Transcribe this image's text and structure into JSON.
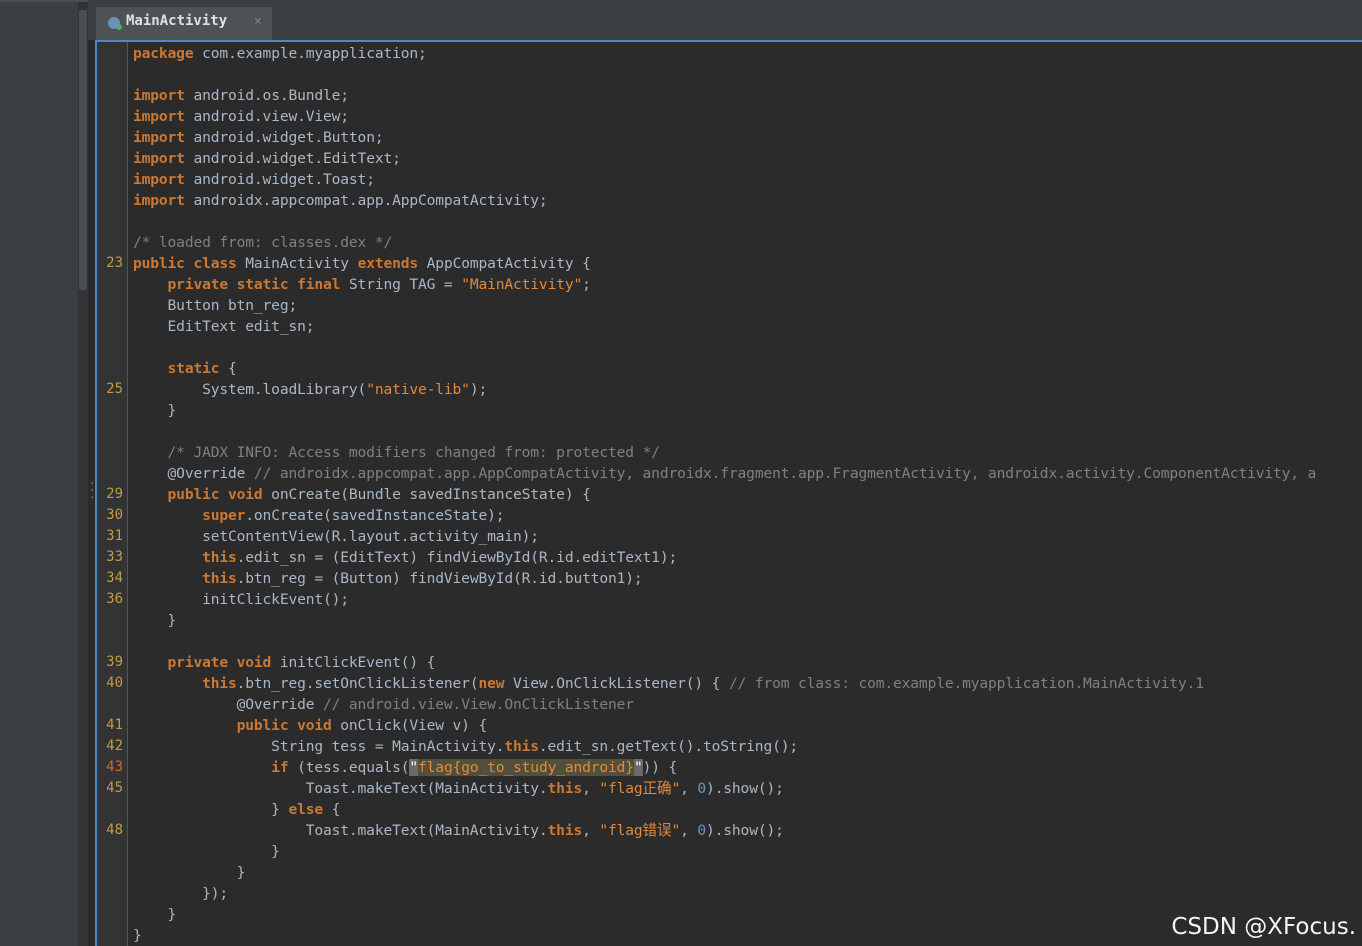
{
  "tab": {
    "title": "MainActivity",
    "close": "×"
  },
  "watermark": "CSDN @XFocus.",
  "lines": [
    {
      "n": "",
      "tokens": [
        {
          "t": "kw",
          "v": "package"
        },
        {
          "t": "p",
          "v": " com.example.myapplication;"
        }
      ]
    },
    {
      "n": "",
      "tokens": []
    },
    {
      "n": "",
      "tokens": [
        {
          "t": "kw",
          "v": "import"
        },
        {
          "t": "p",
          "v": " android.os.Bundle;"
        }
      ]
    },
    {
      "n": "",
      "tokens": [
        {
          "t": "kw",
          "v": "import"
        },
        {
          "t": "p",
          "v": " android.view.View;"
        }
      ]
    },
    {
      "n": "",
      "tokens": [
        {
          "t": "kw",
          "v": "import"
        },
        {
          "t": "p",
          "v": " android.widget.Button;"
        }
      ]
    },
    {
      "n": "",
      "tokens": [
        {
          "t": "kw",
          "v": "import"
        },
        {
          "t": "p",
          "v": " android.widget.EditText;"
        }
      ]
    },
    {
      "n": "",
      "tokens": [
        {
          "t": "kw",
          "v": "import"
        },
        {
          "t": "p",
          "v": " android.widget.Toast;"
        }
      ]
    },
    {
      "n": "",
      "tokens": [
        {
          "t": "kw",
          "v": "import"
        },
        {
          "t": "p",
          "v": " androidx.appcompat.app.AppCompatActivity;"
        }
      ]
    },
    {
      "n": "",
      "tokens": []
    },
    {
      "n": "",
      "tokens": [
        {
          "t": "cmt",
          "v": "/* loaded from: classes.dex */"
        }
      ]
    },
    {
      "n": "23",
      "tokens": [
        {
          "t": "kw",
          "v": "public class"
        },
        {
          "t": "p",
          "v": " MainActivity "
        },
        {
          "t": "kw",
          "v": "extends"
        },
        {
          "t": "p",
          "v": " AppCompatActivity {"
        }
      ]
    },
    {
      "n": "",
      "tokens": [
        {
          "t": "p",
          "v": "    "
        },
        {
          "t": "kw",
          "v": "private static final"
        },
        {
          "t": "p",
          "v": " String TAG = "
        },
        {
          "t": "str2",
          "v": "\"MainActivity\""
        },
        {
          "t": "p",
          "v": ";"
        }
      ]
    },
    {
      "n": "",
      "tokens": [
        {
          "t": "p",
          "v": "    Button btn_reg;"
        }
      ]
    },
    {
      "n": "",
      "tokens": [
        {
          "t": "p",
          "v": "    EditText edit_sn;"
        }
      ]
    },
    {
      "n": "",
      "tokens": []
    },
    {
      "n": "",
      "tokens": [
        {
          "t": "p",
          "v": "    "
        },
        {
          "t": "kw",
          "v": "static"
        },
        {
          "t": "p",
          "v": " {"
        }
      ]
    },
    {
      "n": "25",
      "tokens": [
        {
          "t": "p",
          "v": "        System.loadLibrary("
        },
        {
          "t": "str2",
          "v": "\"native-lib\""
        },
        {
          "t": "p",
          "v": ");"
        }
      ]
    },
    {
      "n": "",
      "tokens": [
        {
          "t": "p",
          "v": "    }"
        }
      ]
    },
    {
      "n": "",
      "tokens": []
    },
    {
      "n": "",
      "tokens": [
        {
          "t": "p",
          "v": "    "
        },
        {
          "t": "cmt",
          "v": "/* JADX INFO: Access modifiers changed from: protected */"
        }
      ]
    },
    {
      "n": "",
      "tokens": [
        {
          "t": "p",
          "v": "    "
        },
        {
          "t": "p",
          "v": "@Override"
        },
        {
          "t": "cmt",
          "v": " // androidx.appcompat.app.AppCompatActivity, androidx.fragment.app.FragmentActivity, androidx.activity.ComponentActivity, a"
        }
      ]
    },
    {
      "n": "29",
      "tokens": [
        {
          "t": "p",
          "v": "    "
        },
        {
          "t": "kw",
          "v": "public void"
        },
        {
          "t": "p",
          "v": " onCreate(Bundle savedInstanceState) {"
        }
      ]
    },
    {
      "n": "30",
      "tokens": [
        {
          "t": "p",
          "v": "        "
        },
        {
          "t": "kw",
          "v": "super"
        },
        {
          "t": "p",
          "v": ".onCreate(savedInstanceState);"
        }
      ]
    },
    {
      "n": "31",
      "tokens": [
        {
          "t": "p",
          "v": "        setContentView(R.layout.activity_main);"
        }
      ]
    },
    {
      "n": "33",
      "tokens": [
        {
          "t": "p",
          "v": "        "
        },
        {
          "t": "kw",
          "v": "this"
        },
        {
          "t": "p",
          "v": ".edit_sn = (EditText) findViewById(R.id.editText1);"
        }
      ]
    },
    {
      "n": "34",
      "tokens": [
        {
          "t": "p",
          "v": "        "
        },
        {
          "t": "kw",
          "v": "this"
        },
        {
          "t": "p",
          "v": ".btn_reg = (Button) findViewById(R.id.button1);"
        }
      ]
    },
    {
      "n": "36",
      "tokens": [
        {
          "t": "p",
          "v": "        initClickEvent();"
        }
      ]
    },
    {
      "n": "",
      "tokens": [
        {
          "t": "p",
          "v": "    }"
        }
      ]
    },
    {
      "n": "",
      "tokens": []
    },
    {
      "n": "39",
      "tokens": [
        {
          "t": "p",
          "v": "    "
        },
        {
          "t": "kw",
          "v": "private void"
        },
        {
          "t": "p",
          "v": " initClickEvent() {"
        }
      ]
    },
    {
      "n": "40",
      "tokens": [
        {
          "t": "p",
          "v": "        "
        },
        {
          "t": "kw",
          "v": "this"
        },
        {
          "t": "p",
          "v": ".btn_reg.setOnClickListener("
        },
        {
          "t": "kw",
          "v": "new"
        },
        {
          "t": "p",
          "v": " View.OnClickListener() { "
        },
        {
          "t": "cmt",
          "v": "// from class: com.example.myapplication.MainActivity.1"
        }
      ]
    },
    {
      "n": "",
      "tokens": [
        {
          "t": "p",
          "v": "            @Override"
        },
        {
          "t": "cmt",
          "v": " // android.view.View.OnClickListener"
        }
      ]
    },
    {
      "n": "41",
      "tokens": [
        {
          "t": "p",
          "v": "            "
        },
        {
          "t": "kw",
          "v": "public void"
        },
        {
          "t": "p",
          "v": " onClick(View v) {"
        }
      ]
    },
    {
      "n": "42",
      "tokens": [
        {
          "t": "p",
          "v": "                String tess = MainActivity."
        },
        {
          "t": "kw",
          "v": "this"
        },
        {
          "t": "p",
          "v": ".edit_sn.getText().toString();"
        }
      ]
    },
    {
      "n": "43",
      "hot": true,
      "tokens": [
        {
          "t": "p",
          "v": "                "
        },
        {
          "t": "kw",
          "v": "if"
        },
        {
          "t": "p",
          "v": " (tess.equals("
        },
        {
          "t": "caret",
          "v": "\""
        },
        {
          "t": "str2 hl",
          "v": "flag{go_to_study_android}"
        },
        {
          "t": "caret",
          "v": "\""
        },
        {
          "t": "p",
          "v": ")) {"
        }
      ]
    },
    {
      "n": "45",
      "tokens": [
        {
          "t": "p",
          "v": "                    Toast.makeText(MainActivity."
        },
        {
          "t": "kw",
          "v": "this"
        },
        {
          "t": "p",
          "v": ", "
        },
        {
          "t": "str2",
          "v": "\"flag正确\""
        },
        {
          "t": "p",
          "v": ", "
        },
        {
          "t": "num",
          "v": "0"
        },
        {
          "t": "p",
          "v": ").show();"
        }
      ]
    },
    {
      "n": "",
      "tokens": [
        {
          "t": "p",
          "v": "                } "
        },
        {
          "t": "kw",
          "v": "else"
        },
        {
          "t": "p",
          "v": " {"
        }
      ]
    },
    {
      "n": "48",
      "tokens": [
        {
          "t": "p",
          "v": "                    Toast.makeText(MainActivity."
        },
        {
          "t": "kw",
          "v": "this"
        },
        {
          "t": "p",
          "v": ", "
        },
        {
          "t": "str2",
          "v": "\"flag错误\""
        },
        {
          "t": "p",
          "v": ", "
        },
        {
          "t": "num",
          "v": "0"
        },
        {
          "t": "p",
          "v": ").show();"
        }
      ]
    },
    {
      "n": "",
      "tokens": [
        {
          "t": "p",
          "v": "                }"
        }
      ]
    },
    {
      "n": "",
      "tokens": [
        {
          "t": "p",
          "v": "            }"
        }
      ]
    },
    {
      "n": "",
      "tokens": [
        {
          "t": "p",
          "v": "        });"
        }
      ]
    },
    {
      "n": "",
      "tokens": [
        {
          "t": "p",
          "v": "    }"
        }
      ]
    },
    {
      "n": "",
      "tokens": [
        {
          "t": "p",
          "v": "}"
        }
      ]
    }
  ]
}
